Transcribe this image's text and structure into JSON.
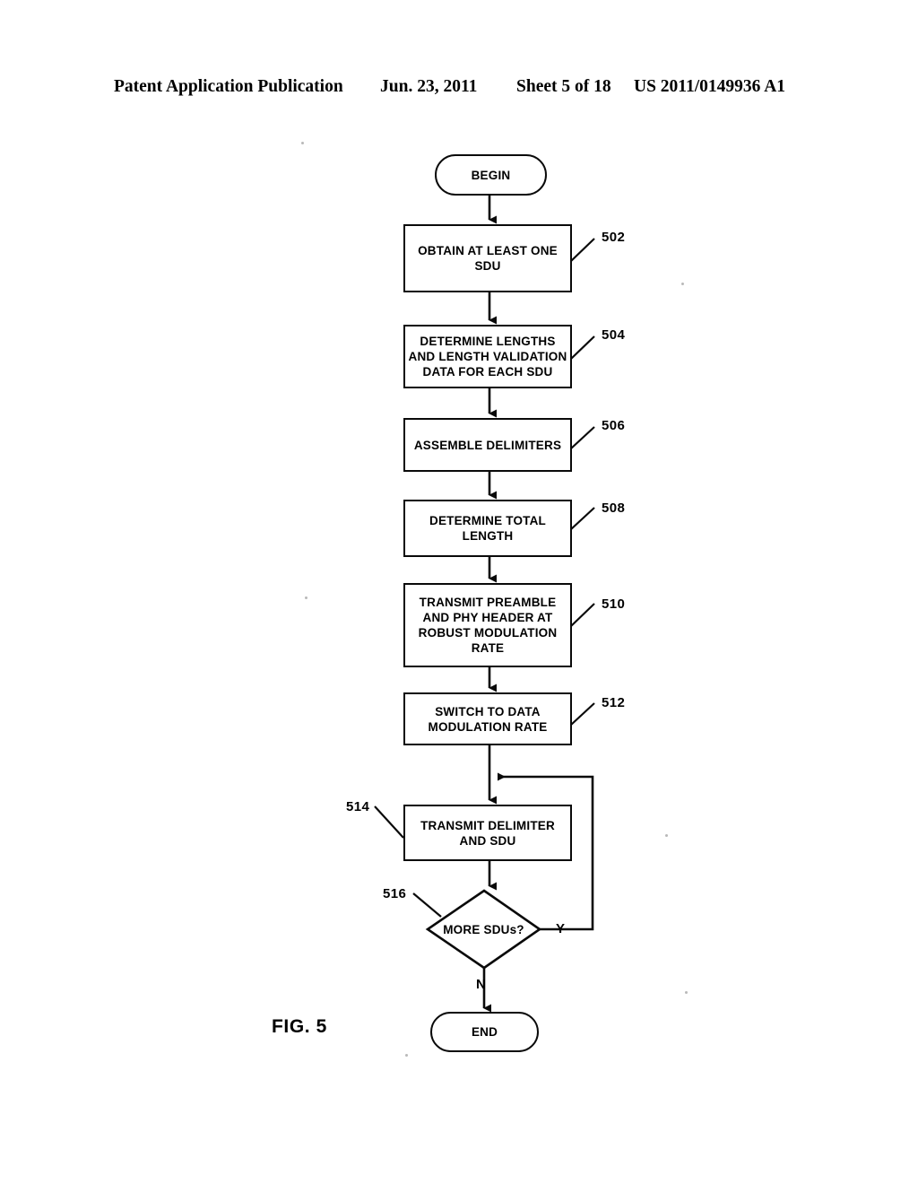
{
  "header": {
    "publication": "Patent Application Publication",
    "date": "Jun. 23, 2011",
    "sheet": "Sheet 5 of 18",
    "document_number": "US 2011/0149936 A1"
  },
  "figure": {
    "caption": "FIG. 5",
    "type": "flowchart",
    "nodes": [
      {
        "id": "begin",
        "shape": "terminator",
        "text": "BEGIN",
        "ref": null
      },
      {
        "id": "n502",
        "shape": "process",
        "text": "OBTAIN AT LEAST ONE SDU",
        "ref": "502"
      },
      {
        "id": "n504",
        "shape": "process",
        "text": "DETERMINE LENGTHS AND LENGTH VALIDATION DATA FOR EACH SDU",
        "ref": "504"
      },
      {
        "id": "n506",
        "shape": "process",
        "text": "ASSEMBLE DELIMITERS",
        "ref": "506"
      },
      {
        "id": "n508",
        "shape": "process",
        "text": "DETERMINE TOTAL LENGTH",
        "ref": "508"
      },
      {
        "id": "n510",
        "shape": "process",
        "text": "TRANSMIT PREAMBLE AND PHY HEADER AT ROBUST MODULATION RATE",
        "ref": "510"
      },
      {
        "id": "n512",
        "shape": "process",
        "text": "SWITCH TO DATA MODULATION RATE",
        "ref": "512"
      },
      {
        "id": "n514",
        "shape": "process",
        "text": "TRANSMIT DELIMITER AND SDU",
        "ref": "514"
      },
      {
        "id": "n516",
        "shape": "decision",
        "text": "MORE SDUs?",
        "ref": "516"
      },
      {
        "id": "end",
        "shape": "terminator",
        "text": "END",
        "ref": null
      }
    ],
    "node_text": {
      "begin": "BEGIN",
      "n502_line1": "OBTAIN AT LEAST ONE",
      "n502_line2": "SDU",
      "n504_line1": "DETERMINE LENGTHS",
      "n504_line2": "AND LENGTH VALIDATION",
      "n504_line3": "DATA FOR EACH SDU",
      "n506_line1": "ASSEMBLE DELIMITERS",
      "n508_line1": "DETERMINE TOTAL",
      "n508_line2": "LENGTH",
      "n510_line1": "TRANSMIT PREAMBLE",
      "n510_line2": "AND PHY HEADER AT",
      "n510_line3": "ROBUST MODULATION",
      "n510_line4": "RATE",
      "n512_line1": "SWITCH TO DATA",
      "n512_line2": "MODULATION RATE",
      "n514_line1": "TRANSMIT DELIMITER",
      "n514_line2": "AND SDU",
      "n516_line1": "MORE SDUs?",
      "end": "END"
    },
    "ref_labels": {
      "r502": "502",
      "r504": "504",
      "r506": "506",
      "r508": "508",
      "r510": "510",
      "r512": "512",
      "r514": "514",
      "r516": "516"
    },
    "branch_labels": {
      "yes": "Y",
      "no": "N"
    },
    "edges": [
      {
        "from": "begin",
        "to": "n502",
        "label": ""
      },
      {
        "from": "n502",
        "to": "n504",
        "label": ""
      },
      {
        "from": "n504",
        "to": "n506",
        "label": ""
      },
      {
        "from": "n506",
        "to": "n508",
        "label": ""
      },
      {
        "from": "n508",
        "to": "n510",
        "label": ""
      },
      {
        "from": "n510",
        "to": "n512",
        "label": ""
      },
      {
        "from": "n512",
        "to": "n514",
        "label": ""
      },
      {
        "from": "n514",
        "to": "n516",
        "label": ""
      },
      {
        "from": "n516",
        "to": "n514",
        "label": "Y"
      },
      {
        "from": "n516",
        "to": "end",
        "label": "N"
      }
    ]
  },
  "colors": {
    "ink": "#0a0a0a",
    "paper": "#ffffff"
  }
}
